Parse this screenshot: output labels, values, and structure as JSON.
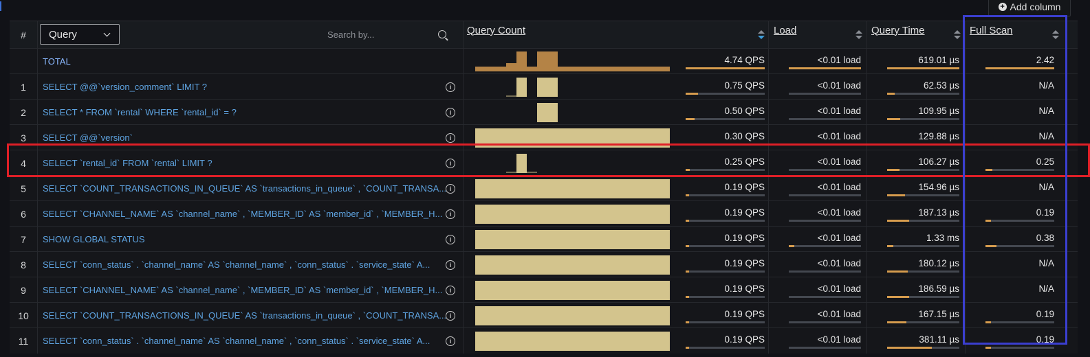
{
  "toolbar": {
    "add_column_label": "Add column"
  },
  "header": {
    "num": "#",
    "query_select": "Query",
    "search_placeholder": "Search by...",
    "columns": [
      "Query Count",
      "Load",
      "Query Time",
      "Full Scan"
    ]
  },
  "colors": {
    "bar": "#d69c4e",
    "spark": "#d3c48d",
    "spark_total": "#b48346",
    "link": "#5ea3e0",
    "highlight_red": "#e01f27",
    "highlight_blue": "#3b3fd0"
  },
  "total": {
    "label": "TOTAL",
    "qps": "4.74 QPS",
    "load": "<0.01 load",
    "time": "619.01 µs",
    "full_scan": "2.42",
    "bars": {
      "qps": 1.0,
      "load": 1.0,
      "time": 1.0,
      "full_scan": 1.0
    }
  },
  "rows": [
    {
      "n": "1",
      "query": "SELECT @@`version_comment` LIMIT ?",
      "qps": "0.75 QPS",
      "load": "<0.01 load",
      "time": "62.53 µs",
      "full_scan": "N/A",
      "bars": {
        "qps": 0.16,
        "load": 0.0,
        "time": 0.1,
        "full_scan": null
      },
      "spark": "two"
    },
    {
      "n": "2",
      "query": "SELECT * FROM `rental` WHERE `rental_id` = ?",
      "qps": "0.50 QPS",
      "load": "<0.01 load",
      "time": "109.95 µs",
      "full_scan": "N/A",
      "bars": {
        "qps": 0.11,
        "load": 0.0,
        "time": 0.18,
        "full_scan": null
      },
      "spark": "right"
    },
    {
      "n": "3",
      "query": "SELECT @@`version`",
      "qps": "0.30 QPS",
      "load": "<0.01 load",
      "time": "129.88 µs",
      "full_scan": "N/A",
      "bars": {
        "qps": 0.06,
        "load": 0.0,
        "time": 0.21,
        "full_scan": null
      },
      "spark": "full"
    },
    {
      "n": "4",
      "query": "SELECT `rental_id` FROM `rental` LIMIT ?",
      "qps": "0.25 QPS",
      "load": "<0.01 load",
      "time": "106.27 µs",
      "full_scan": "0.25",
      "bars": {
        "qps": 0.05,
        "load": 0.0,
        "time": 0.17,
        "full_scan": 0.1
      },
      "spark": "single"
    },
    {
      "n": "5",
      "query": "SELECT `COUNT_TRANSACTIONS_IN_QUEUE` AS `transactions_in_queue` , `COUNT_TRANSA...",
      "qps": "0.19 QPS",
      "load": "<0.01 load",
      "time": "154.96 µs",
      "full_scan": "N/A",
      "bars": {
        "qps": 0.04,
        "load": 0.0,
        "time": 0.25,
        "full_scan": null
      },
      "spark": "full"
    },
    {
      "n": "6",
      "query": "SELECT `CHANNEL_NAME` AS `channel_name` , `MEMBER_ID` AS `member_id` , `MEMBER_H...",
      "qps": "0.19 QPS",
      "load": "<0.01 load",
      "time": "187.13 µs",
      "full_scan": "0.19",
      "bars": {
        "qps": 0.04,
        "load": 0.0,
        "time": 0.3,
        "full_scan": 0.08
      },
      "spark": "full"
    },
    {
      "n": "7",
      "query": "SHOW GLOBAL STATUS",
      "qps": "0.19 QPS",
      "load": "<0.01 load",
      "time": "1.33 ms",
      "full_scan": "0.38",
      "bars": {
        "qps": 0.04,
        "load": 0.08,
        "time": 0.09,
        "full_scan": 0.16
      },
      "spark": "full"
    },
    {
      "n": "8",
      "query": "SELECT `conn_status` . `channel_name` AS `channel_name` , `conn_status` . `service_state` A...",
      "qps": "0.19 QPS",
      "load": "<0.01 load",
      "time": "180.12 µs",
      "full_scan": "N/A",
      "bars": {
        "qps": 0.04,
        "load": 0.0,
        "time": 0.29,
        "full_scan": null
      },
      "spark": "full"
    },
    {
      "n": "9",
      "query": "SELECT `CHANNEL_NAME` AS `channel_name` , `MEMBER_ID` AS `member_id` , `MEMBER_H...",
      "qps": "0.19 QPS",
      "load": "<0.01 load",
      "time": "186.59 µs",
      "full_scan": "N/A",
      "bars": {
        "qps": 0.04,
        "load": 0.0,
        "time": 0.3,
        "full_scan": null
      },
      "spark": "full"
    },
    {
      "n": "10",
      "query": "SELECT `COUNT_TRANSACTIONS_IN_QUEUE` AS `transactions_in_queue` , `COUNT_TRANSA...",
      "qps": "0.19 QPS",
      "load": "<0.01 load",
      "time": "167.15 µs",
      "full_scan": "0.19",
      "bars": {
        "qps": 0.04,
        "load": 0.0,
        "time": 0.27,
        "full_scan": 0.08
      },
      "spark": "full"
    },
    {
      "n": "11",
      "query": "SELECT `conn_status` . `channel_name` AS `channel_name` , `conn_status` . `service_state` A...",
      "qps": "0.19 QPS",
      "load": "<0.01 load",
      "time": "381.11 µs",
      "full_scan": "0.19",
      "bars": {
        "qps": 0.04,
        "load": 0.0,
        "time": 0.62,
        "full_scan": 0.08
      },
      "spark": "full"
    }
  ]
}
